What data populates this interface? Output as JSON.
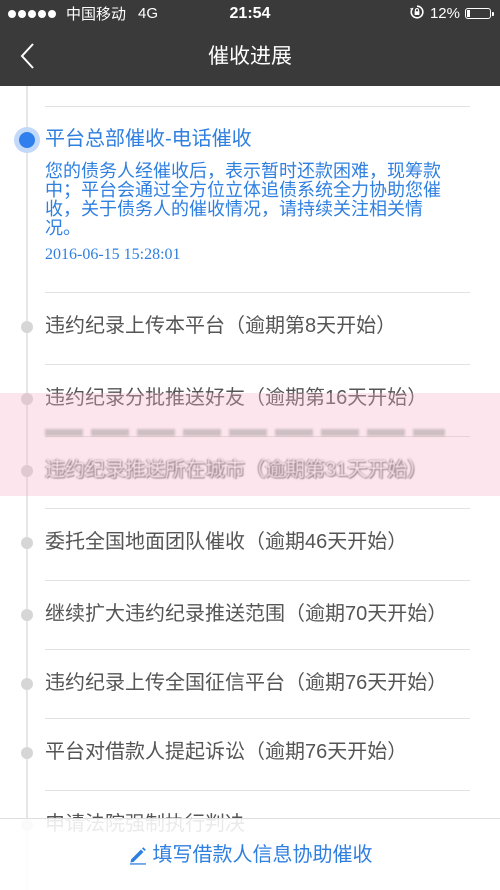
{
  "status_bar": {
    "signal_bars": 5,
    "carrier": "中国移动",
    "network": "4G",
    "time": "21:54",
    "orientation_icon": "orientation-lock-icon",
    "battery_percent": "12%",
    "battery_level": 0.12
  },
  "nav": {
    "back_icon": "chevron-left-icon",
    "title": "催收进展"
  },
  "timeline": {
    "active": {
      "title": "平台总部催收-电话催收",
      "description": "您的债务人经催收后，表示暂时还款困难，现筹款中；平台会通过全方位立体追债系统全力协助您催收，关于债务人的催收情况，请持续关注相关情况。",
      "time": "2016-06-15 15:28:01"
    },
    "steps": [
      {
        "text": "违约纪录上传本平台（逾期第8天开始）"
      },
      {
        "text": "违约纪录分批推送好友（逾期第16天开始）"
      },
      {
        "text": "违约纪录推送所在城市（逾期第31天开始）"
      },
      {
        "text": "委托全国地面团队催收（逾期46天开始）"
      },
      {
        "text": "继续扩大违约纪录推送范围（逾期70天开始）"
      },
      {
        "text": "违约纪录上传全国征信平台（逾期76天开始）"
      },
      {
        "text": "平台对借款人提起诉讼（逾期76天开始）"
      },
      {
        "text": "申请法院强制执行判决"
      }
    ]
  },
  "footer": {
    "icon": "pencil-icon",
    "action_label": "填写借款人信息协助催收"
  },
  "colors": {
    "header_bg": "#3a3a3a",
    "accent": "#2f7fe0",
    "step_text": "#555555",
    "dot_inactive": "#d6d6d6",
    "overlay": "#f7b0c4"
  }
}
